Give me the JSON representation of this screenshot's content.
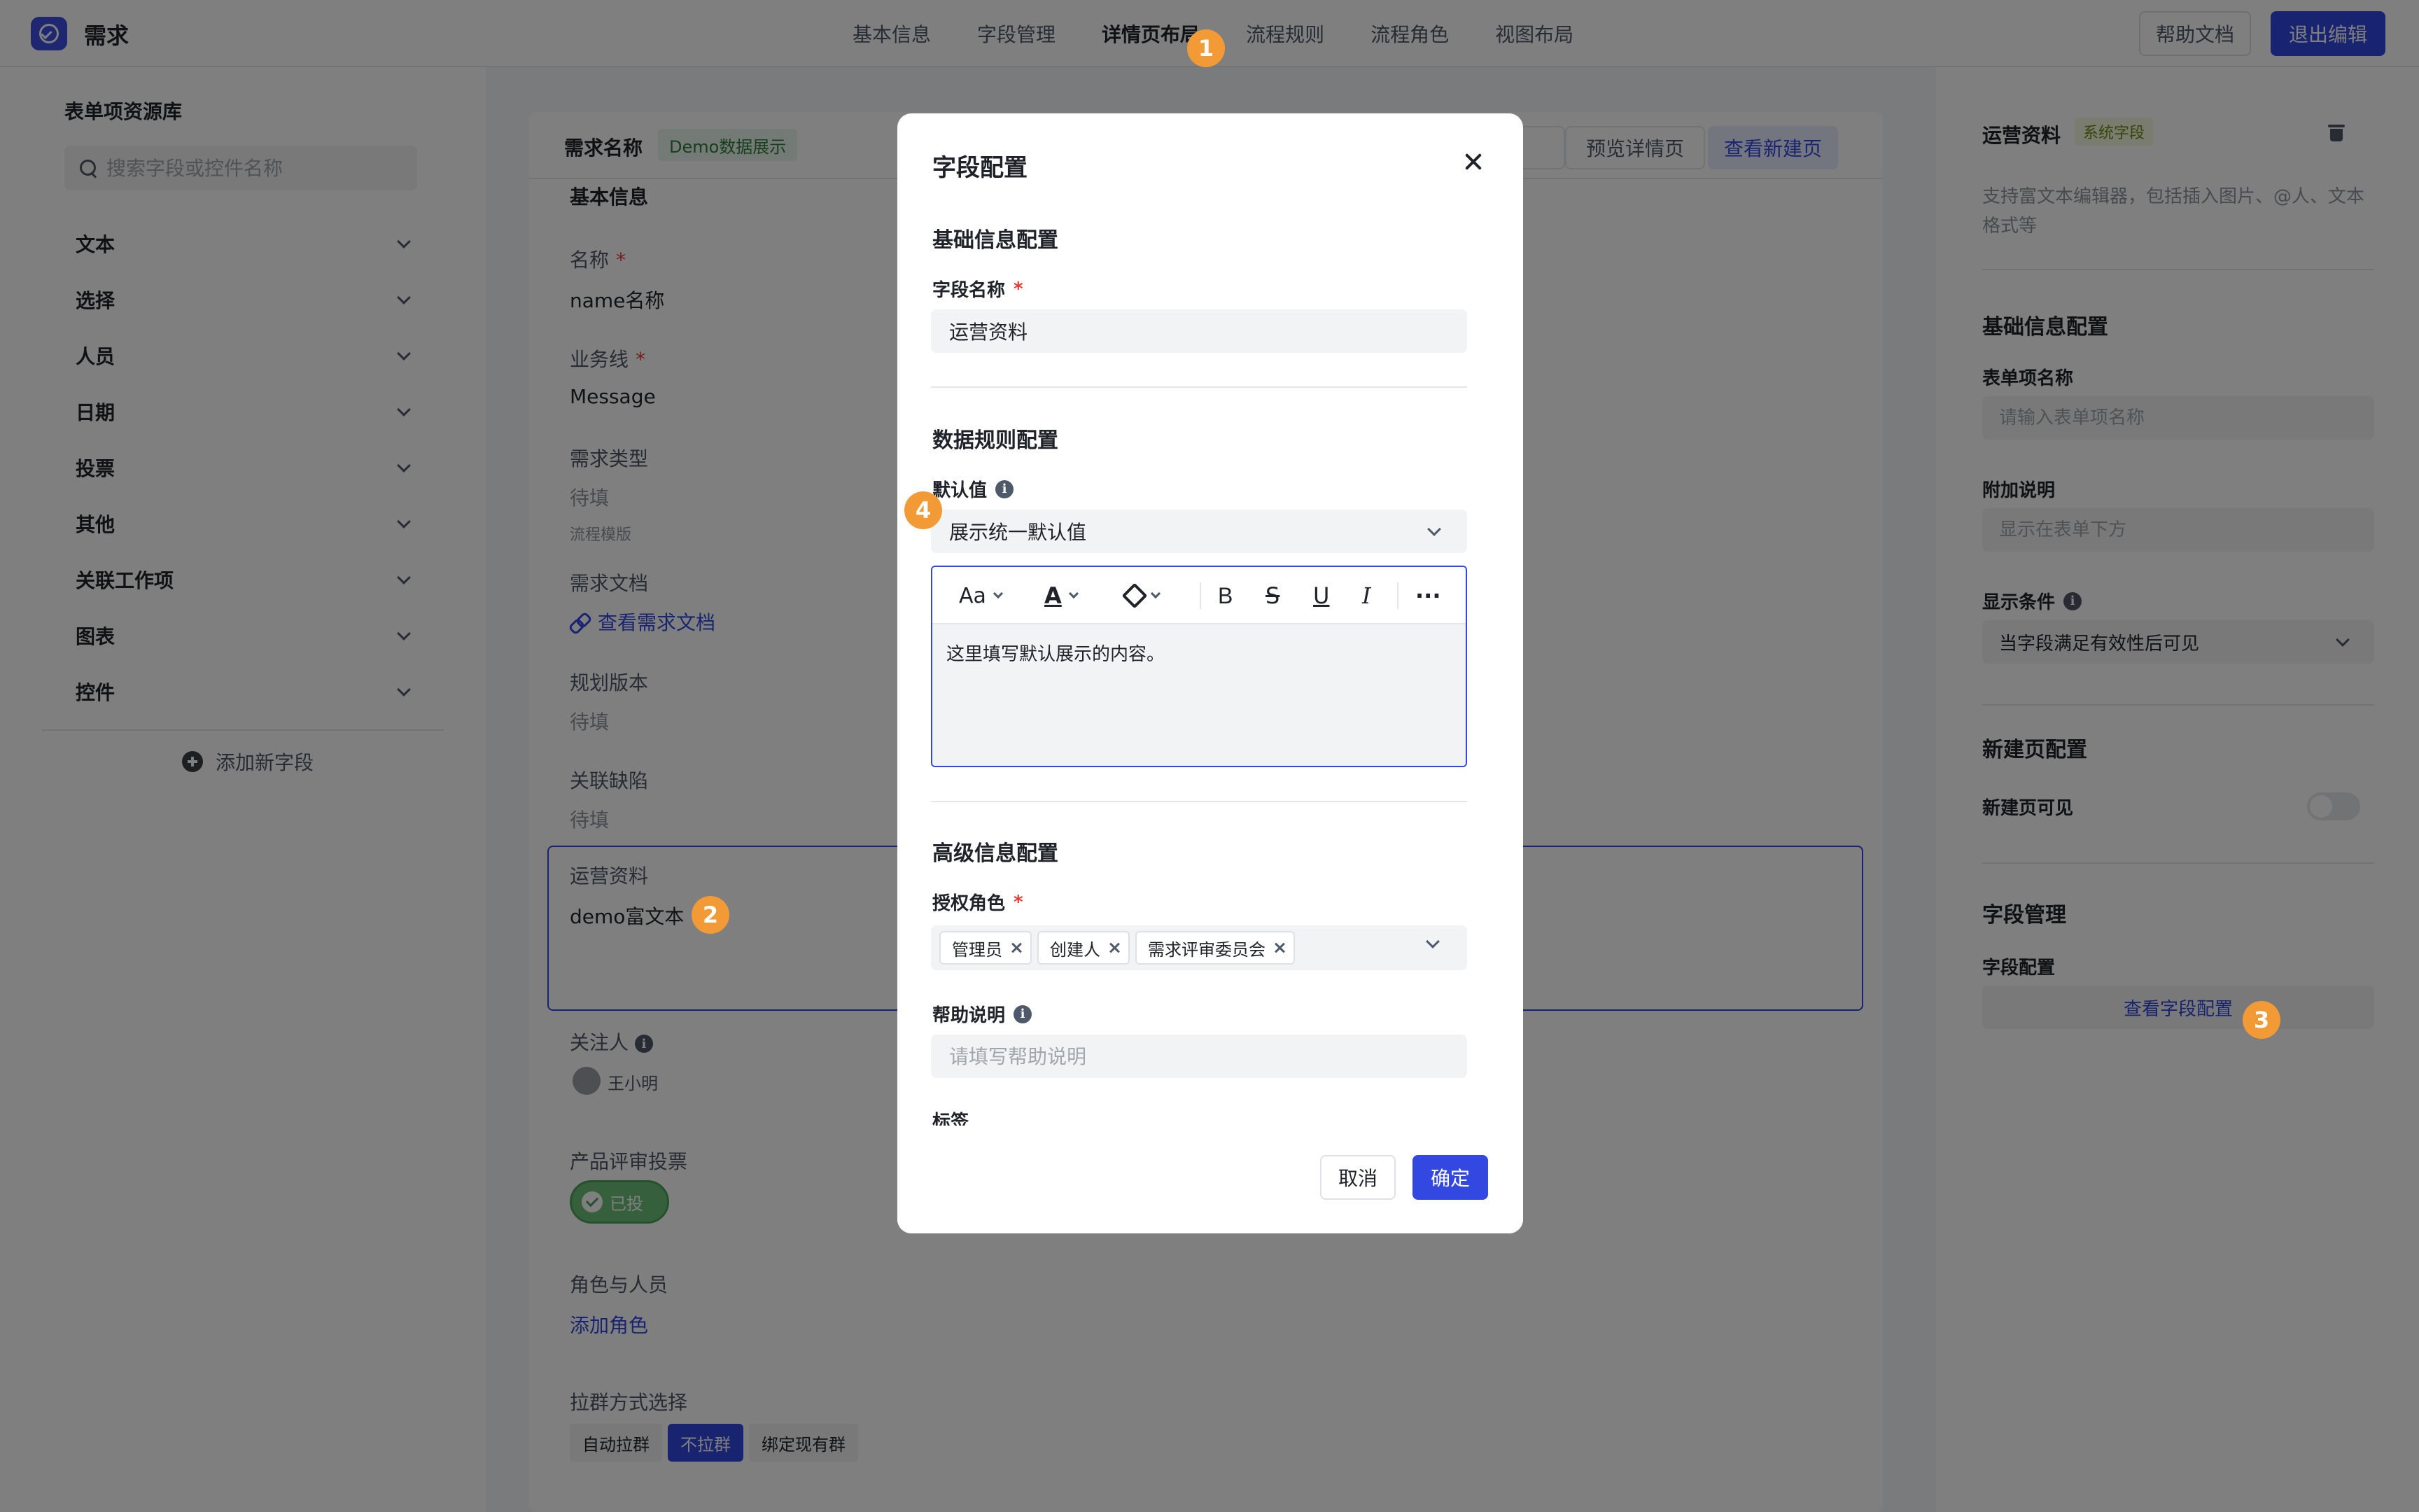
{
  "app": {
    "title": "需求"
  },
  "tabs": [
    "基本信息",
    "字段管理",
    "详情页布局",
    "流程规则",
    "流程角色",
    "视图布局"
  ],
  "header_buttons": {
    "help": "帮助文档",
    "exit": "退出编辑"
  },
  "left_panel": {
    "title": "表单项资源库",
    "search_placeholder": "搜索字段或控件名称",
    "categories": [
      "文本",
      "选择",
      "人员",
      "日期",
      "投票",
      "其他",
      "关联工作项",
      "图表",
      "控件"
    ],
    "add_field": "添加新字段"
  },
  "canvas": {
    "title": "需求名称",
    "tag": "Demo数据展示",
    "preview_button": "预览详情页",
    "new_page_button": "查看新建页",
    "section": "基本信息",
    "fields": {
      "name": {
        "label": "名称",
        "value": "name名称"
      },
      "biz": {
        "label": "业务线",
        "value": "Message"
      },
      "type": {
        "label": "需求类型",
        "value": "待填",
        "sub": "流程模版"
      },
      "doc": {
        "label": "需求文档",
        "link": "查看需求文档"
      },
      "version": {
        "label": "规划版本",
        "value": "待填"
      },
      "bug": {
        "label": "关联缺陷",
        "value": "待填"
      },
      "ops": {
        "label": "运营资料",
        "value": "demo富文本"
      },
      "follower": {
        "label": "关注人",
        "value": "王小明"
      },
      "vote": {
        "label": "产品评审投票",
        "value": "已投"
      },
      "roles": {
        "label": "角色与人员",
        "link": "添加角色"
      },
      "group": {
        "label": "拉群方式选择",
        "options": [
          "自动拉群",
          "不拉群",
          "绑定现有群"
        ],
        "selected": "不拉群"
      }
    },
    "required_mark": "*"
  },
  "right_panel": {
    "field_name": "运营资料",
    "system_tag": "系统字段",
    "description": "支持富文本编辑器，包括插入图片、@人、文本格式等",
    "basic_section": "基础信息配置",
    "item_name_label": "表单项名称",
    "item_name_placeholder": "请输入表单项名称",
    "extra_label": "附加说明",
    "extra_placeholder": "显示在表单下方",
    "condition_label": "显示条件",
    "condition_value": "当字段满足有效性后可见",
    "new_page_section": "新建页配置",
    "new_page_visible": "新建页可见",
    "new_page_visible_on": false,
    "field_mgmt_section": "字段管理",
    "field_config_label": "字段配置",
    "view_config_button": "查看字段配置"
  },
  "modal": {
    "title": "字段配置",
    "basic_section": "基础信息配置",
    "field_name_label": "字段名称",
    "field_name_value": "运营资料",
    "rules_section": "数据规则配置",
    "default_label": "默认值",
    "default_select": "展示统一默认值",
    "editor_tools": [
      "font-size",
      "font-color",
      "fill-color",
      "bold",
      "strikethrough",
      "underline",
      "italic",
      "more"
    ],
    "editor_tool_glyphs": {
      "font_size": "Aa",
      "font_color": "A",
      "bold": "B",
      "strike": "S",
      "underline": "U",
      "italic": "I",
      "more": "···"
    },
    "editor_content": "这里填写默认展示的内容。",
    "advanced_section": "高级信息配置",
    "roles_label": "授权角色",
    "roles": [
      "管理员",
      "创建人",
      "需求评审委员会"
    ],
    "help_label": "帮助说明",
    "help_placeholder": "请填写帮助说明",
    "cut_label": "标签",
    "cancel": "取消",
    "ok": "确定"
  },
  "callouts": [
    "1",
    "2",
    "3",
    "4"
  ],
  "colors": {
    "primary": "#3348e0",
    "callout": "#f29a36",
    "required": "#e23c39",
    "success": "#6cc078"
  }
}
